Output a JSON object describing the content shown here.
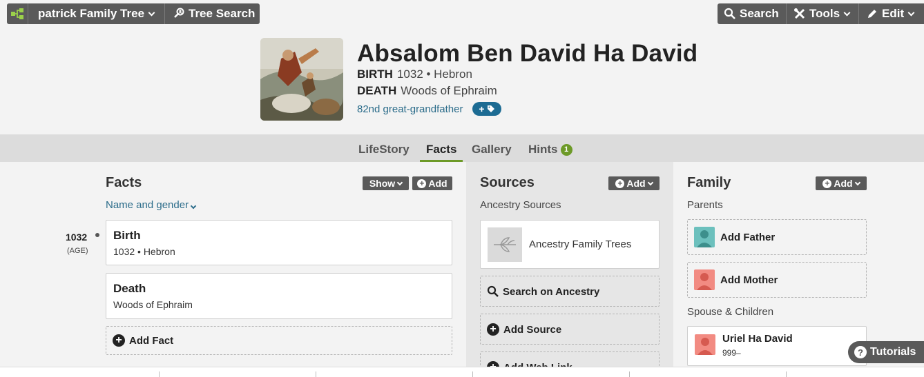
{
  "topbar": {
    "tree_name": "patrick Family Tree",
    "tree_search": "Tree Search",
    "search": "Search",
    "tools": "Tools",
    "edit": "Edit"
  },
  "profile": {
    "name": "Absalom Ben David Ha David",
    "birth_label": "BIRTH",
    "birth_value": "1032 • Hebron",
    "death_label": "DEATH",
    "death_value": "Woods of Ephraim",
    "relationship": "82nd great-grandfather"
  },
  "tabs": {
    "lifestory": "LifeStory",
    "facts": "Facts",
    "gallery": "Gallery",
    "hints": "Hints",
    "hints_count": "1"
  },
  "facts": {
    "title": "Facts",
    "show_label": "Show",
    "add_label": "Add",
    "name_gender": "Name and gender",
    "timeline_year": "1032",
    "timeline_age": "(AGE)",
    "items": [
      {
        "title": "Birth",
        "detail": "1032 • Hebron"
      },
      {
        "title": "Death",
        "detail": "Woods of Ephraim"
      }
    ],
    "add_fact": "Add Fact"
  },
  "sources": {
    "title": "Sources",
    "add_label": "Add",
    "subhead": "Ancestry Sources",
    "family_trees": "Ancestry Family Trees",
    "search_ancestry": "Search on Ancestry",
    "add_source": "Add Source",
    "add_web_link": "Add Web Link"
  },
  "family": {
    "title": "Family",
    "add_label": "Add",
    "parents_head": "Parents",
    "add_father": "Add Father",
    "add_mother": "Add Mother",
    "spouse_head": "Spouse & Children",
    "spouse_name": "Uriel Ha David",
    "spouse_dates": "999–"
  },
  "tutorials": "Tutorials",
  "colors": {
    "accent_green": "#6d9a28",
    "link_blue": "#2b6c8a",
    "toolbar_gray": "#5a5a5a",
    "male_teal": "#6cc0bd",
    "female_pink": "#f28b82"
  }
}
